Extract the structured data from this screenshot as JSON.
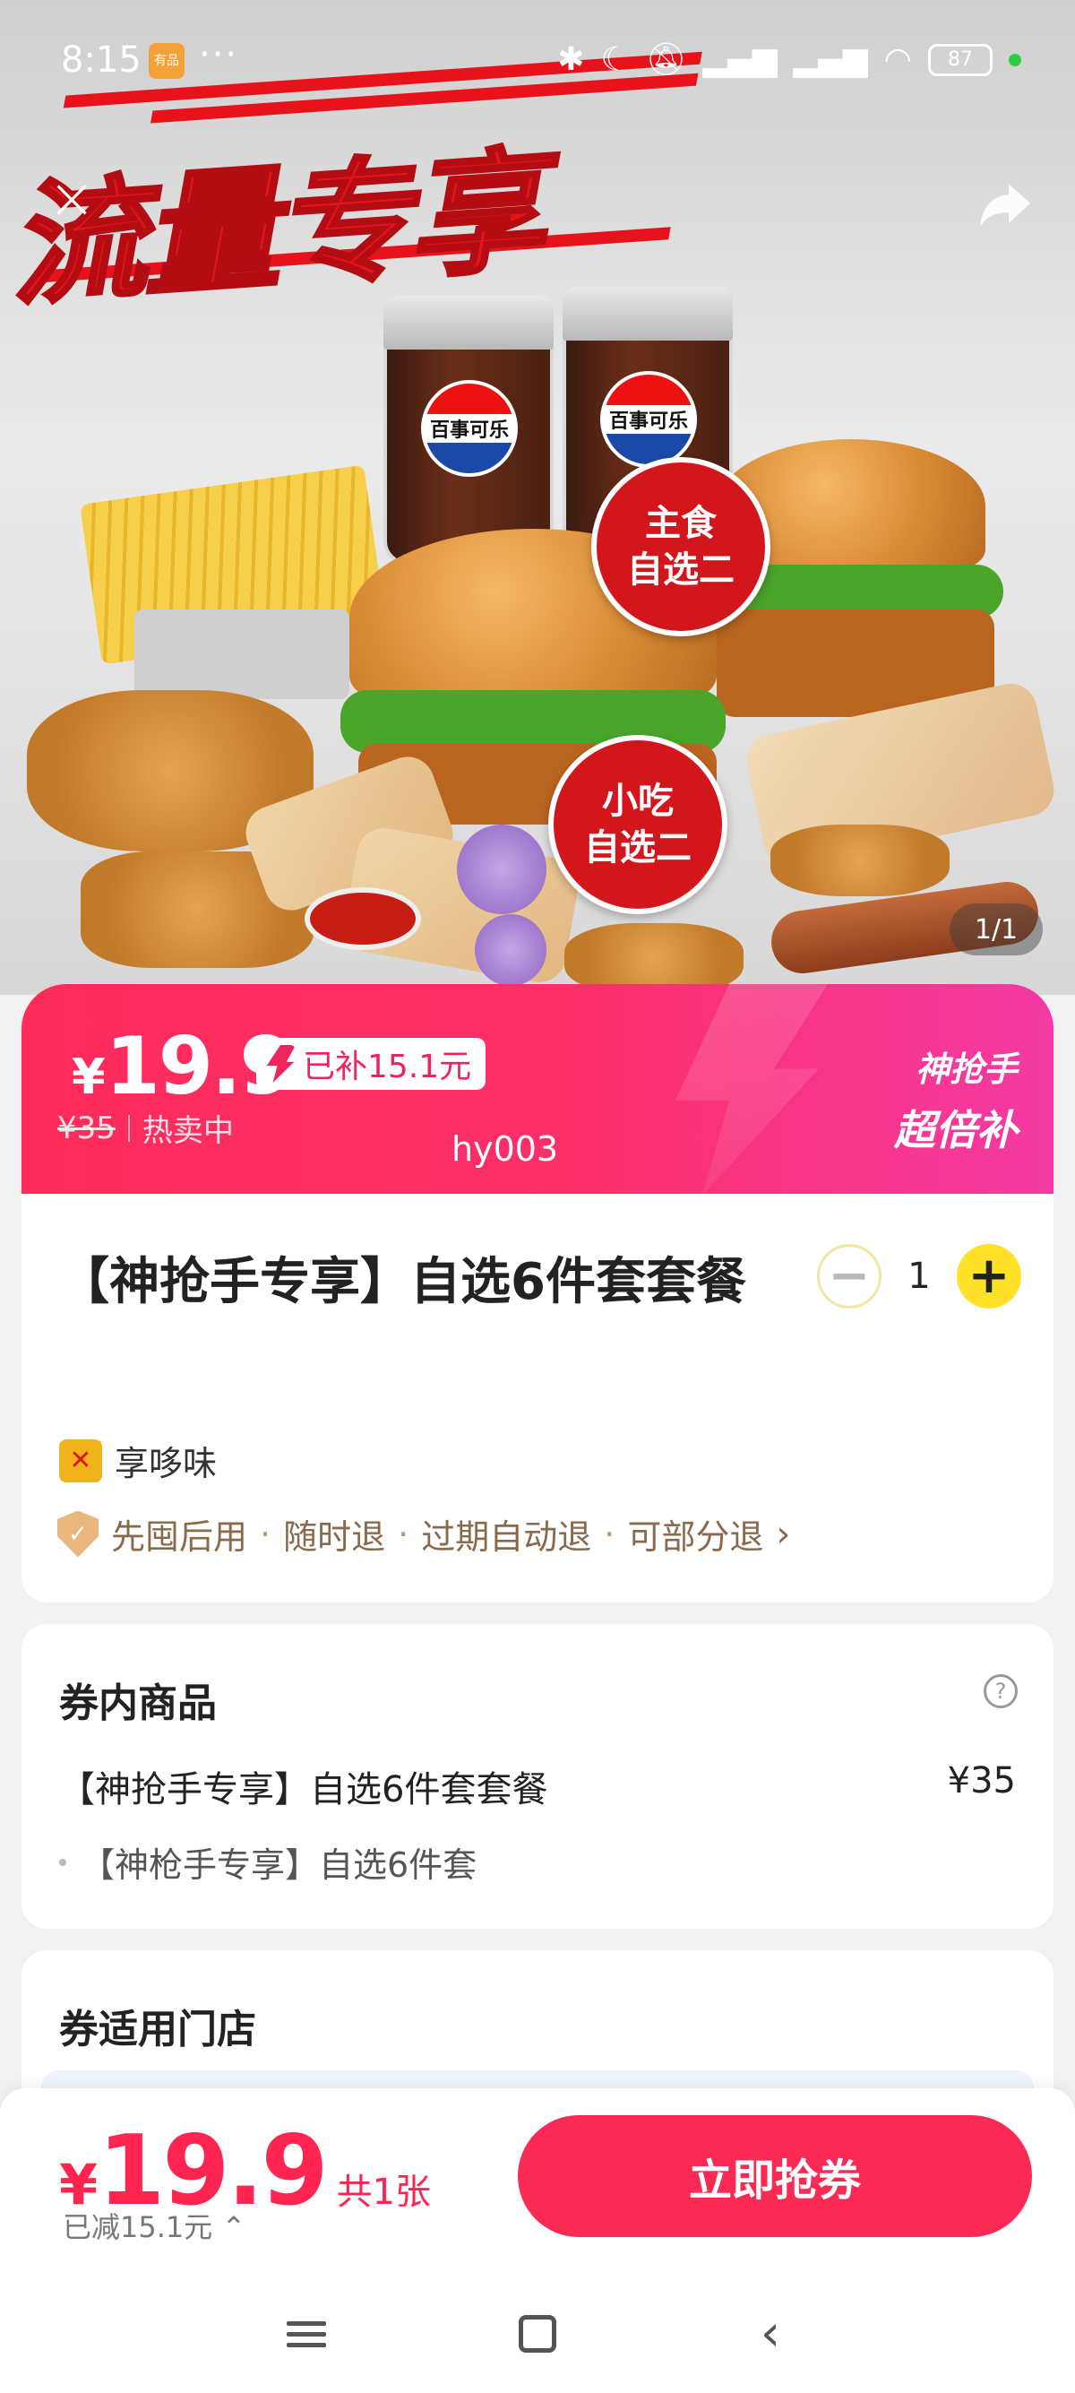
{
  "status_bar": {
    "time": "8:15",
    "app_icon_text": "有品",
    "overflow": "···",
    "icons": [
      "bluetooth-icon",
      "moon-icon",
      "mute-icon",
      "signal-hd-icon",
      "signal-hd-icon",
      "wifi-icon"
    ],
    "battery": "87"
  },
  "hero": {
    "banner_text": "流量专享",
    "badge_main": [
      "主食",
      "自选二"
    ],
    "badge_snack": [
      "小吃",
      "自选二"
    ],
    "cup_brand": "百事可乐",
    "counter": "1/1"
  },
  "price_banner": {
    "currency": "¥",
    "price": "19.9",
    "subsidy": "已补15.1元",
    "original_price": "¥35",
    "status": "热卖中",
    "id": "hy003",
    "promo_line1": "神抢手",
    "promo_line2": "超倍补"
  },
  "product": {
    "title": "【神抢手专享】自选6件套套餐",
    "quantity": "1",
    "merchant": "享哆味",
    "guarantees": [
      "先囤后用",
      "随时退",
      "过期自动退",
      "可部分退"
    ]
  },
  "coupon_items": {
    "title": "券内商品",
    "item_name": "【神抢手专享】自选6件套套餐",
    "item_price": "¥35",
    "sub_item": "【神枪手专享】自选6件套"
  },
  "stores": {
    "title": "券适用门店"
  },
  "bottom_bar": {
    "currency": "¥",
    "price": "19.9",
    "count": "共1张",
    "saved": "已减15.1元",
    "cta": "立即抢券"
  },
  "colors": {
    "primary": "#fa2a55",
    "banner_start": "#ff2c5a",
    "banner_end": "#f43aa4",
    "plus_button": "#ffe12a",
    "guarantee_text": "#8a6a4d"
  }
}
